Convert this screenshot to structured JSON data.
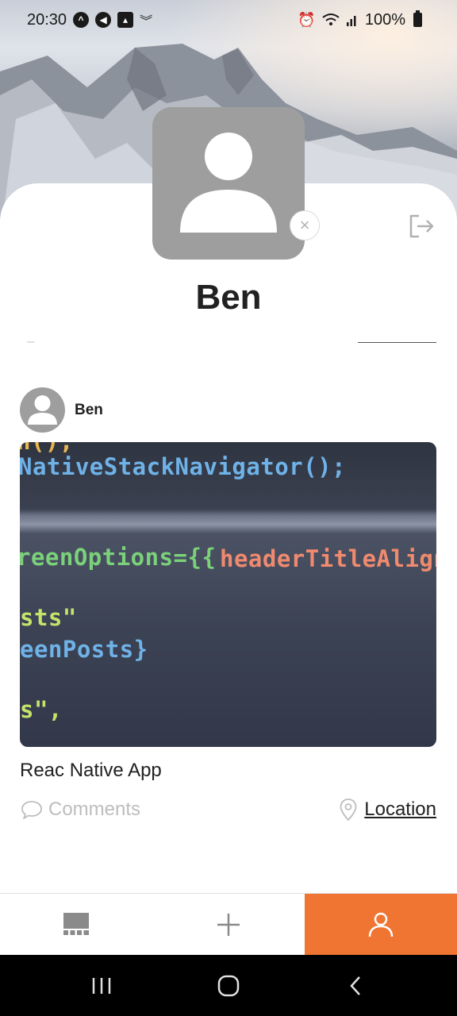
{
  "status_bar": {
    "time": "20:30",
    "battery": "100%",
    "left_icons": [
      "app-notification-icon",
      "megaphone-icon",
      "image-icon",
      "message-icon"
    ],
    "right_icons": [
      "alarm-icon",
      "wifi-icon",
      "signal-icon",
      "battery-icon"
    ]
  },
  "profile": {
    "name": "Ben",
    "avatar_icon": "user-placeholder-icon",
    "remove_label": "×",
    "logout_icon": "logout-icon"
  },
  "post": {
    "author": "Ben",
    "title": "Reac Native App",
    "comments_label": "Comments",
    "location_label": "Location",
    "code_lines": [
      "n();",
      "NativeStackNavigator();",
      "reenOptions={{",
      "headerTitleAlign:",
      "sts\"",
      "eenPosts}",
      "s\","
    ]
  },
  "tab_bar": {
    "tabs": [
      {
        "name": "posts",
        "icon": "grid-icon",
        "active": false
      },
      {
        "name": "create",
        "icon": "plus-icon",
        "active": false
      },
      {
        "name": "profile",
        "icon": "user-icon",
        "active": true
      }
    ],
    "active_color": "#f07533"
  },
  "system_nav": {
    "buttons": [
      "recent-apps-icon",
      "home-icon",
      "back-icon"
    ]
  }
}
